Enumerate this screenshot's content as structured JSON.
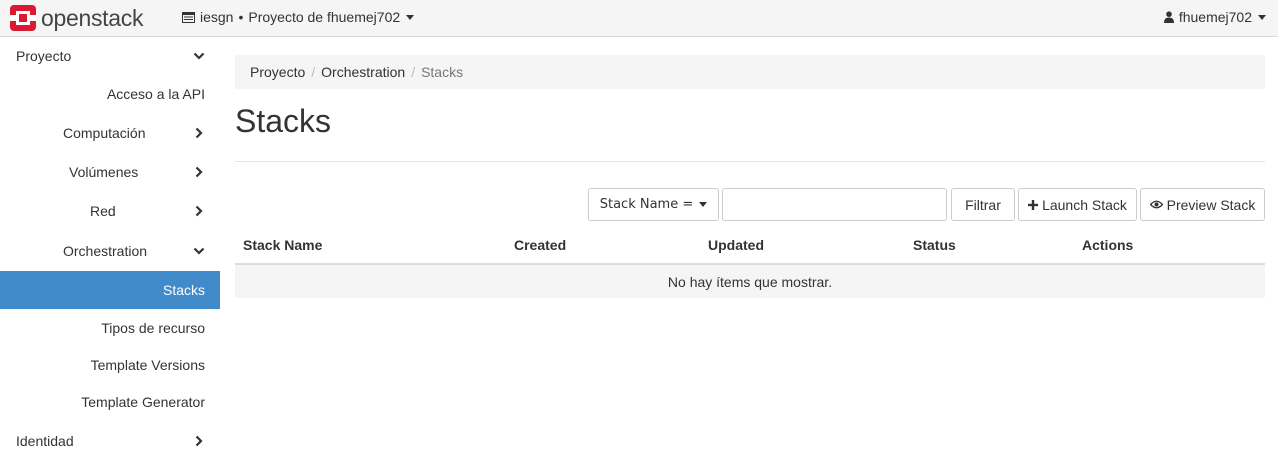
{
  "brand": {
    "name": "openstack"
  },
  "topbar": {
    "domain": "iesgn",
    "separator": "•",
    "project": "Proyecto de fhuemej702",
    "user": "fhuemej702"
  },
  "sidebar": {
    "items": [
      {
        "label": "Proyecto",
        "chevron": "down"
      },
      {
        "label": "Acceso a la API"
      },
      {
        "label": "Computación",
        "chevron": "right"
      },
      {
        "label": "Volúmenes",
        "chevron": "right"
      },
      {
        "label": "Red",
        "chevron": "right"
      },
      {
        "label": "Orchestration",
        "chevron": "down"
      },
      {
        "label": "Stacks",
        "active": true
      },
      {
        "label": "Tipos de recurso"
      },
      {
        "label": "Template Versions"
      },
      {
        "label": "Template Generator"
      },
      {
        "label": "Identidad",
        "chevron": "right"
      }
    ]
  },
  "breadcrumb": {
    "items": [
      "Proyecto",
      "Orchestration",
      "Stacks"
    ],
    "divider": "/"
  },
  "page": {
    "title": "Stacks"
  },
  "toolbar": {
    "filter_field": "Stack Name =",
    "filter_value": "",
    "filter_button": "Filtrar",
    "launch_button": "Launch Stack",
    "preview_button": "Preview Stack"
  },
  "table": {
    "columns": [
      "Stack Name",
      "Created",
      "Updated",
      "Status",
      "Actions"
    ],
    "empty_message": "No hay ítems que mostrar."
  },
  "colors": {
    "accent": "#428bca",
    "brand_red": "#da1a32"
  },
  "icons": {
    "project_switch": "server-icon",
    "user": "user-icon",
    "launch": "plus-icon",
    "preview": "eye-icon"
  }
}
